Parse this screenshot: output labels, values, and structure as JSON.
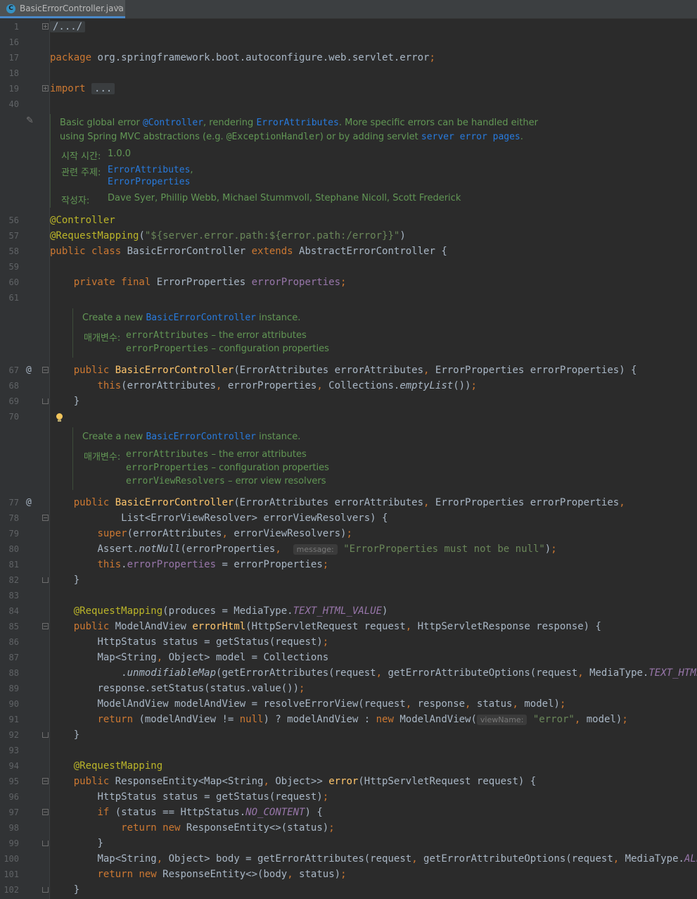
{
  "tab": {
    "icon": "C",
    "label": "BasicErrorController.java",
    "close": "×"
  },
  "gutter": {
    "at": "@",
    "fold_plus": "+",
    "fold_minus": "−"
  },
  "line_numbers": {
    "l1": "1",
    "l16": "16",
    "l17": "17",
    "l18": "18",
    "l19": "19",
    "l40": "40",
    "l56": "56",
    "l57": "57",
    "l58": "58",
    "l59": "59",
    "l60": "60",
    "l61": "61",
    "l67": "67",
    "l68": "68",
    "l69": "69",
    "l70": "70",
    "l77": "77",
    "l78": "78",
    "l79": "79",
    "l80": "80",
    "l81": "81",
    "l82": "82",
    "l83": "83",
    "l84": "84",
    "l85": "85",
    "l86": "86",
    "l87": "87",
    "l88": "88",
    "l89": "89",
    "l90": "90",
    "l91": "91",
    "l92": "92",
    "l93": "93",
    "l94": "94",
    "l95": "95",
    "l96": "96",
    "l97": "97",
    "l98": "98",
    "l99": "99",
    "l100": "100",
    "l101": "101",
    "l102": "102"
  },
  "code": {
    "l1_fold": "/.../",
    "l17_kw": "package",
    "l17_pkg": " org.springframework.boot.autoconfigure.web.servlet.error",
    "semi": ";",
    "l19_kw": "import",
    "l19_fold": "...",
    "l56_ann": "@Controller",
    "l57_ann": "@RequestMapping",
    "l57_open": "(",
    "l57_str": "\"${server.error.path:${error.path:/error}}\"",
    "l57_close": ")",
    "l58_kw": "public class",
    "l58_a": " BasicErrorController ",
    "l58_kw2": "extends",
    "l58_b": " AbstractErrorController {",
    "l60_kw": "private final",
    "l60_type": " ErrorProperties ",
    "l60_field": "errorProperties",
    "l67_kw": "public",
    "l67_fn": "BasicErrorController",
    "l67_a": "(ErrorAttributes errorAttributes",
    "comma": ",",
    "l67_b": " ErrorProperties errorProperties) {",
    "l68_kw": "this",
    "l68_a": "(errorAttributes",
    "l68_b": " errorProperties",
    "l68_c": " Collections.",
    "l68_it": "emptyList",
    "l68_d": "())",
    "brace_close": "}",
    "l77_b": " ErrorProperties errorProperties",
    "l78_a": "List<ErrorViewResolver> errorViewResolvers) {",
    "l79_kw": "super",
    "l79_a": "(errorAttributes",
    "l79_b": " errorViewResolvers)",
    "l80_a": "Assert.",
    "l80_it": "notNull",
    "l80_b": "(errorProperties",
    "l80_hint": "message:",
    "l80_str": "\"ErrorProperties must not be null\"",
    "l80_c": ")",
    "l81_kw": "this",
    "l81_dot": ".",
    "l81_field": "errorProperties",
    "l81_a": " = errorProperties",
    "l84_ann": "@RequestMapping",
    "l84_a": "(produces = MediaType.",
    "l84_const": "TEXT_HTML_VALUE",
    "l84_b": ")",
    "l85_kw": "public",
    "l85_a": " ModelAndView ",
    "l85_fn": "errorHtml",
    "l85_b": "(HttpServletRequest request",
    "l85_c": " HttpServletResponse response) {",
    "l86_a": "HttpStatus status = getStatus(request)",
    "l87_a": "Map<String",
    "l87_b": " Object> model = Collections",
    "l88_dot": ".",
    "l88_it": "unmodifiableMap",
    "l88_a": "(getErrorAttributes(request",
    "l88_b": " getErrorAttributeOptions(request",
    "l88_c": " MediaType.",
    "l88_const": "TEXT_HTML",
    "l88_d": ")))",
    "l89_a": "response.setStatus(status.value())",
    "l90_a": "ModelAndView modelAndView = resolveErrorView(request",
    "l90_b": " response",
    "l90_c": " status",
    "l90_d": " model)",
    "l91_kw": "return",
    "l91_a": " (modelAndView != ",
    "l91_null": "null",
    "l91_b": ") ? modelAndView : ",
    "l91_new": "new",
    "l91_c": " ModelAndView(",
    "l91_hint": "viewName:",
    "l91_str": "\"error\"",
    "l91_d": " model)",
    "l94_ann": "@RequestMapping",
    "l95_kw": "public",
    "l95_a": " ResponseEntity<Map<String",
    "l95_b": " Object>> ",
    "l95_fn": "error",
    "l95_c": "(HttpServletRequest request) {",
    "l96_a": "HttpStatus status = getStatus(request)",
    "l97_kw": "if",
    "l97_a": " (status == HttpStatus.",
    "l97_const": "NO_CONTENT",
    "l97_b": ") {",
    "l98_kw": "return",
    "l98_new": "new",
    "l98_a": " ResponseEntity<>(status)",
    "l100_a": "Map<String",
    "l100_b": " Object> body = getErrorAttributes(request",
    "l100_c": " getErrorAttributeOptions(request",
    "l100_d": " MediaType.",
    "l100_const": "ALL",
    "l100_e": "))",
    "l101_kw": "return",
    "l101_new": "new",
    "l101_a": " ResponseEntity<>(body",
    "l101_b": " status)"
  },
  "doc_class": {
    "a1": "Basic global error ",
    "a2": "@Controller",
    "a3": ", rendering ",
    "a4": "ErrorAttributes",
    "a5": ". More specific errors can be handled either",
    "b1": "using Spring MVC abstractions (e.g. ",
    "b2": "@ExceptionHandler",
    "b3": ") or by adding servlet ",
    "b4": "server error pages",
    "b5": ".",
    "since_label": "시작 시간:",
    "since_value": "1.0.0",
    "see_label": "관련 주제:",
    "see_1": "ErrorAttributes",
    "see_1_comma": ",",
    "see_2": "ErrorProperties",
    "author_label": "작성자:",
    "author_value": "Dave Syer, Phillip Webb, Michael Stummvoll, Stephane Nicoll, Scott Frederick"
  },
  "doc_ctor1": {
    "c1": "Create a new ",
    "c2": "BasicErrorController",
    "c3": " instance.",
    "param_label": "매개변수:",
    "p1_name": "errorAttributes",
    "p1_desc": " – the error attributes",
    "p2_name": "errorProperties",
    "p2_desc": " – configuration properties"
  },
  "doc_ctor2": {
    "c1": "Create a new ",
    "c2": "BasicErrorController",
    "c3": " instance.",
    "param_label": "매개변수:",
    "p1_name": "errorAttributes",
    "p1_desc": " – the error attributes",
    "p2_name": "errorProperties",
    "p2_desc": " – configuration properties",
    "p3_name": "errorViewResolvers",
    "p3_desc": " – error view resolvers"
  },
  "colors": {
    "keyword": "#cc7832",
    "annotation": "#bbb529",
    "string": "#6a8759",
    "field": "#9876aa",
    "method": "#ffc66d",
    "doc": "#629755",
    "link": "#287bde",
    "text": "#a9b7c6"
  }
}
